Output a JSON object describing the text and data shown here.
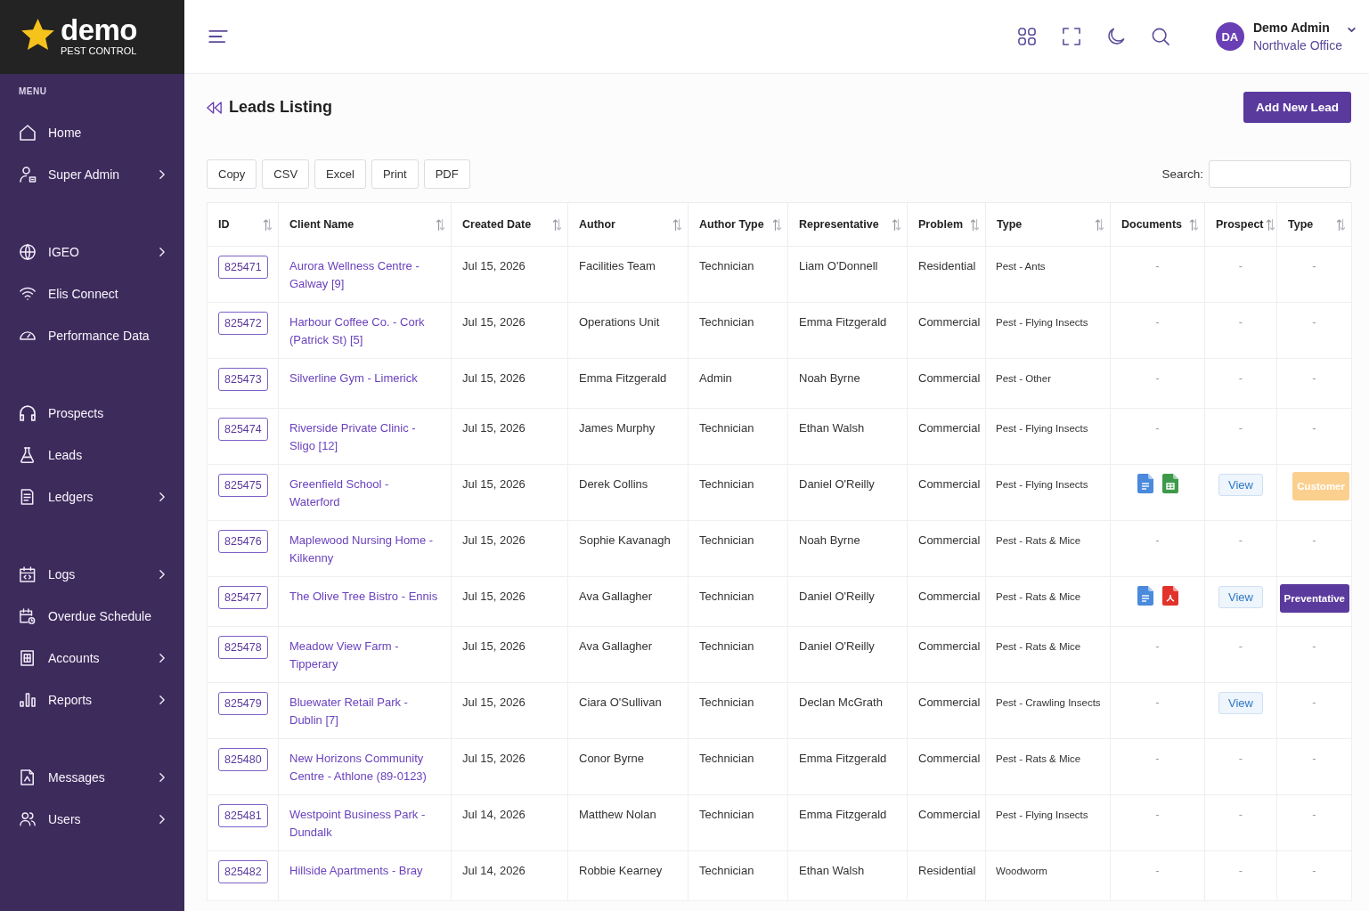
{
  "brand": {
    "name": "demo",
    "tagline": "PEST CONTROL"
  },
  "sidebar": {
    "heading": "MENU",
    "groups": [
      {
        "items": [
          {
            "label": "Home",
            "has_submenu": false
          },
          {
            "label": "Super Admin",
            "has_submenu": true
          }
        ]
      },
      {
        "items": [
          {
            "label": "IGEO",
            "has_submenu": true
          },
          {
            "label": "Elis Connect",
            "has_submenu": false
          },
          {
            "label": "Performance Data",
            "has_submenu": false
          }
        ]
      },
      {
        "items": [
          {
            "label": "Prospects",
            "has_submenu": false
          },
          {
            "label": "Leads",
            "has_submenu": false
          },
          {
            "label": "Ledgers",
            "has_submenu": true
          }
        ]
      },
      {
        "items": [
          {
            "label": "Logs",
            "has_submenu": true
          },
          {
            "label": "Overdue Schedule",
            "has_submenu": false
          },
          {
            "label": "Accounts",
            "has_submenu": true
          },
          {
            "label": "Reports",
            "has_submenu": true
          }
        ]
      },
      {
        "items": [
          {
            "label": "Messages",
            "has_submenu": true
          },
          {
            "label": "Users",
            "has_submenu": true
          }
        ]
      }
    ]
  },
  "user": {
    "initials": "DA",
    "name": "Demo Admin",
    "office": "Northvale Office"
  },
  "page": {
    "title": "Leads Listing",
    "primary_action": "Add New Lead"
  },
  "export_buttons": [
    "Copy",
    "CSV",
    "Excel",
    "Print",
    "PDF"
  ],
  "search": {
    "label": "Search:"
  },
  "table": {
    "columns": [
      "ID",
      "Client Name",
      "Created Date",
      "Author",
      "Author Type",
      "Representative",
      "Problem",
      "Type",
      "Documents",
      "Prospect",
      "Type"
    ],
    "rows": [
      {
        "id": "825471",
        "client": "Aurora Wellness Centre - Galway [9]",
        "created": "Jul 15, 2026",
        "author": "Facilities Team",
        "author_type": "Technician",
        "representative": "Liam O'Donnell",
        "problem": "Residential",
        "type": "Pest - Ants",
        "documents": {
          "kind": "dash",
          "text": "-"
        },
        "prospect": {
          "kind": "dash",
          "text": "-"
        },
        "lead_type": {
          "kind": "dash",
          "text": "-"
        }
      },
      {
        "id": "825472",
        "client": "Harbour Coffee Co. - Cork (Patrick St) [5]",
        "created": "Jul 15, 2026",
        "author": "Operations Unit",
        "author_type": "Technician",
        "representative": "Emma Fitzgerald",
        "problem": "Commercial",
        "type": "Pest - Flying Insects",
        "documents": {
          "kind": "dash",
          "text": "-"
        },
        "prospect": {
          "kind": "dash",
          "text": "-"
        },
        "lead_type": {
          "kind": "dash",
          "text": "-"
        }
      },
      {
        "id": "825473",
        "client": "Silverline Gym - Limerick",
        "created": "Jul 15, 2026",
        "author": "Emma Fitzgerald",
        "author_type": "Admin",
        "representative": "Noah Byrne",
        "problem": "Commercial",
        "type": "Pest - Other",
        "documents": {
          "kind": "dash",
          "text": "-"
        },
        "prospect": {
          "kind": "dash",
          "text": "-"
        },
        "lead_type": {
          "kind": "dash",
          "text": "-"
        }
      },
      {
        "id": "825474",
        "client": "Riverside Private Clinic - Sligo [12]",
        "created": "Jul 15, 2026",
        "author": "James Murphy",
        "author_type": "Technician",
        "representative": "Ethan Walsh",
        "problem": "Commercial",
        "type": "Pest - Flying Insects",
        "documents": {
          "kind": "dash",
          "text": "-"
        },
        "prospect": {
          "kind": "dash",
          "text": "-"
        },
        "lead_type": {
          "kind": "dash",
          "text": "-"
        }
      },
      {
        "id": "825475",
        "client": "Greenfield School - Waterford",
        "created": "Jul 15, 2026",
        "author": "Derek Collins",
        "author_type": "Technician",
        "representative": "Daniel O'Reilly",
        "problem": "Commercial",
        "type": "Pest - Flying Insects",
        "documents": {
          "kind": "files",
          "files": [
            {
              "kind": "word"
            },
            {
              "kind": "excel"
            }
          ]
        },
        "prospect": {
          "kind": "button",
          "text": "View"
        },
        "lead_type": {
          "kind": "tag",
          "text": "Customer",
          "color": "#fbd08e"
        }
      },
      {
        "id": "825476",
        "client": "Maplewood Nursing Home - Kilkenny",
        "created": "Jul 15, 2026",
        "author": "Sophie Kavanagh",
        "author_type": "Technician",
        "representative": "Noah Byrne",
        "problem": "Commercial",
        "type": "Pest - Rats & Mice",
        "documents": {
          "kind": "dash",
          "text": "-"
        },
        "prospect": {
          "kind": "dash",
          "text": "-"
        },
        "lead_type": {
          "kind": "dash",
          "text": "-"
        }
      },
      {
        "id": "825477",
        "client": "The Olive Tree Bistro - Ennis",
        "created": "Jul 15, 2026",
        "author": "Ava Gallagher",
        "author_type": "Technician",
        "representative": "Daniel O'Reilly",
        "problem": "Commercial",
        "type": "Pest - Rats & Mice",
        "documents": {
          "kind": "files",
          "files": [
            {
              "kind": "word"
            },
            {
              "kind": "pdf"
            }
          ]
        },
        "prospect": {
          "kind": "button",
          "text": "View"
        },
        "lead_type": {
          "kind": "tag",
          "text": "Preventative",
          "color": "#5b3a9e"
        }
      },
      {
        "id": "825478",
        "client": "Meadow View Farm - Tipperary",
        "created": "Jul 15, 2026",
        "author": "Ava Gallagher",
        "author_type": "Technician",
        "representative": "Daniel O'Reilly",
        "problem": "Commercial",
        "type": "Pest - Rats & Mice",
        "documents": {
          "kind": "dash",
          "text": "-"
        },
        "prospect": {
          "kind": "dash",
          "text": "-"
        },
        "lead_type": {
          "kind": "dash",
          "text": "-"
        }
      },
      {
        "id": "825479",
        "client": "Bluewater Retail Park - Dublin [7]",
        "created": "Jul 15, 2026",
        "author": "Ciara O'Sullivan",
        "author_type": "Technician",
        "representative": "Declan McGrath",
        "problem": "Commercial",
        "type": "Pest - Crawling Insects",
        "documents": {
          "kind": "dash",
          "text": "-"
        },
        "prospect": {
          "kind": "button",
          "text": "View"
        },
        "lead_type": {
          "kind": "dash",
          "text": "-"
        }
      },
      {
        "id": "825480",
        "client": "New Horizons Community Centre - Athlone (89-0123)",
        "created": "Jul 15, 2026",
        "author": "Conor Byrne",
        "author_type": "Technician",
        "representative": "Emma Fitzgerald",
        "problem": "Commercial",
        "type": "Pest - Rats & Mice",
        "documents": {
          "kind": "dash",
          "text": "-"
        },
        "prospect": {
          "kind": "dash",
          "text": "-"
        },
        "lead_type": {
          "kind": "dash",
          "text": "-"
        }
      },
      {
        "id": "825481",
        "client": "Westpoint Business Park - Dundalk",
        "created": "Jul 14, 2026",
        "author": "Matthew Nolan",
        "author_type": "Technician",
        "representative": "Emma Fitzgerald",
        "problem": "Commercial",
        "type": "Pest - Flying Insects",
        "documents": {
          "kind": "dash",
          "text": "-"
        },
        "prospect": {
          "kind": "dash",
          "text": "-"
        },
        "lead_type": {
          "kind": "dash",
          "text": "-"
        }
      },
      {
        "id": "825482",
        "client": "Hillside Apartments - Bray",
        "created": "Jul 14, 2026",
        "author": "Robbie Kearney",
        "author_type": "Technician",
        "representative": "Ethan Walsh",
        "problem": "Residential",
        "type": "Woodworm",
        "documents": {
          "kind": "dash",
          "text": "-"
        },
        "prospect": {
          "kind": "dash",
          "text": "-"
        },
        "lead_type": {
          "kind": "dash",
          "text": "-"
        }
      }
    ]
  }
}
